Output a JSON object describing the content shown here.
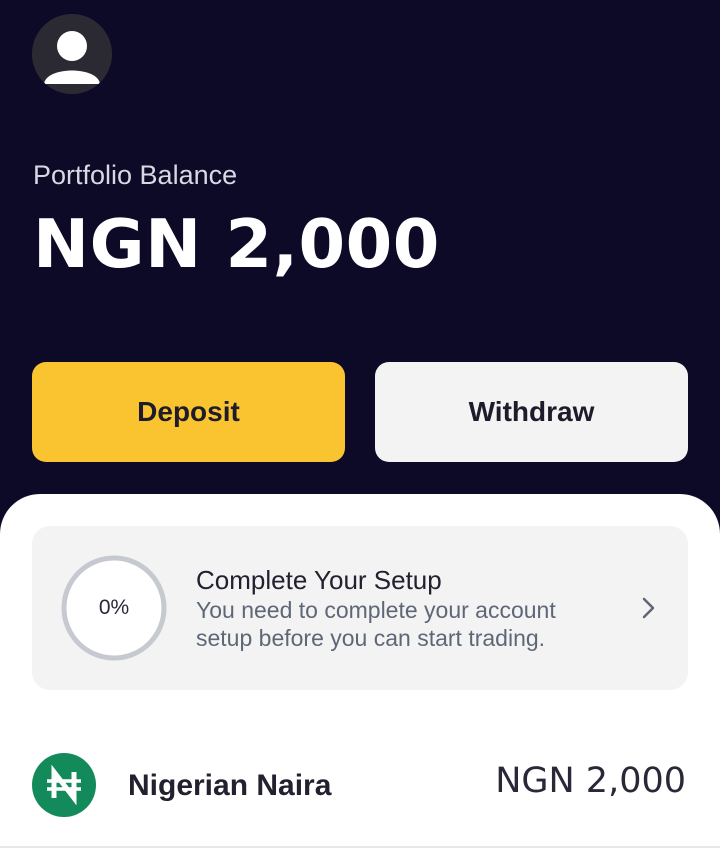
{
  "header": {
    "balance_label": "Portfolio Balance",
    "balance_value": "NGN 2,000"
  },
  "actions": {
    "deposit_label": "Deposit",
    "withdraw_label": "Withdraw"
  },
  "setup": {
    "progress_text": "0%",
    "progress": 0,
    "title": "Complete Your Setup",
    "description": "You need to complete your account setup before you can start trading."
  },
  "assets": [
    {
      "name": "Nigerian Naira",
      "value": "NGN 2,000",
      "icon": "naira-icon"
    }
  ],
  "colors": {
    "background": "#0d0a28",
    "deposit": "#f9c42f",
    "withdraw": "#f3f3f4",
    "naira_green": "#128a5a"
  }
}
